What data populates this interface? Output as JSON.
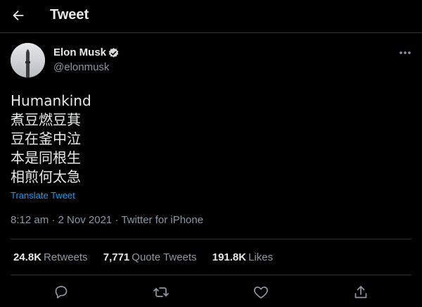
{
  "header": {
    "title": "Tweet",
    "back_icon": "arrow-left-icon"
  },
  "author": {
    "name": "Elon Musk",
    "handle": "@elonmusk",
    "verified_icon": "verified-badge-icon",
    "more_icon": "more-horizontal-icon"
  },
  "tweet": {
    "lines": [
      "Humankind",
      "煮豆燃豆萁",
      "豆在釜中泣",
      "本是同根生",
      "相煎何太急"
    ],
    "translate_label": "Translate Tweet"
  },
  "meta": {
    "time": "8:12 am",
    "sep1": "·",
    "date": "2 Nov 2021",
    "sep2": "·",
    "source": "Twitter for iPhone"
  },
  "stats": [
    {
      "value": "24.8K",
      "label": "Retweets"
    },
    {
      "value": "7,771",
      "label": "Quote Tweets"
    },
    {
      "value": "191.8K",
      "label": "Likes"
    }
  ],
  "actions": [
    "reply-icon",
    "retweet-icon",
    "like-icon",
    "share-icon"
  ],
  "colors": {
    "background": "#000000",
    "link": "#1d9bf0",
    "muted": "#8b98a5",
    "text": "#e7e9ea",
    "verified": "#d9d9d9"
  }
}
